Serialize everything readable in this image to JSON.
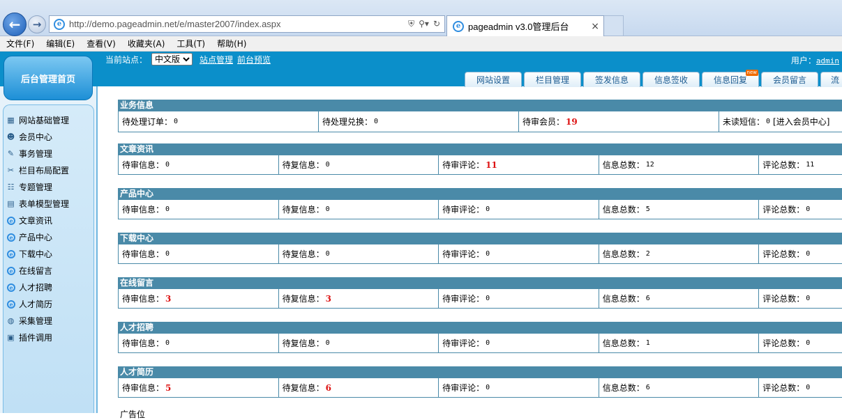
{
  "browser": {
    "url": "http://demo.pageadmin.net/e/master2007/index.aspx",
    "tab_title": "pageadmin v3.0管理后台",
    "menu": [
      "文件(F)",
      "编辑(E)",
      "查看(V)",
      "收藏夹(A)",
      "工具(T)",
      "帮助(H)"
    ]
  },
  "header": {
    "home_label": "后台管理首页",
    "site_label": "当前站点：",
    "site_selected": "中文版",
    "site_manage": "站点管理",
    "preview": "前台预览",
    "user_label": "用户：",
    "user_name": "admin"
  },
  "tabs": [
    {
      "label": "网站设置"
    },
    {
      "label": "栏目管理"
    },
    {
      "label": "签发信息"
    },
    {
      "label": "信息签收"
    },
    {
      "label": "信息回复",
      "badge": "new"
    },
    {
      "label": "会员留言"
    },
    {
      "label": "流"
    }
  ],
  "sidebar": {
    "items": [
      {
        "label": "网站基础管理",
        "icon": "site-manage-icon"
      },
      {
        "label": "会员中心",
        "icon": "members-icon"
      },
      {
        "label": "事务管理",
        "icon": "affairs-icon"
      },
      {
        "label": "栏目布局配置",
        "icon": "tools-icon"
      },
      {
        "label": "专题管理",
        "icon": "topics-icon"
      },
      {
        "label": "表单模型管理",
        "icon": "form-book-icon"
      },
      {
        "label": "文章资讯",
        "icon": "ie-icon"
      },
      {
        "label": "产品中心",
        "icon": "ie-icon"
      },
      {
        "label": "下载中心",
        "icon": "ie-icon"
      },
      {
        "label": "在线留言",
        "icon": "ie-icon"
      },
      {
        "label": "人才招聘",
        "icon": "ie-icon"
      },
      {
        "label": "人才简历",
        "icon": "ie-icon"
      },
      {
        "label": "采集管理",
        "icon": "globe-icon"
      },
      {
        "label": "插件调用",
        "icon": "plugin-icon"
      }
    ]
  },
  "business": {
    "title": "业务信息",
    "cells": [
      {
        "label": "待处理订单：",
        "value": "0"
      },
      {
        "label": "待处理兑换：",
        "value": "0"
      },
      {
        "label": "待审会员：",
        "value": "19",
        "hot": true
      },
      {
        "label": "未读短信：",
        "value": "0",
        "link": "[进入会员中心]"
      }
    ]
  },
  "modules": [
    {
      "title": "文章资讯",
      "cells": [
        [
          "待审信息：",
          "0"
        ],
        [
          "待复信息：",
          "0"
        ],
        [
          "待审评论：",
          "11"
        ],
        [
          "信息总数：",
          "12"
        ],
        [
          "评论总数：",
          "11"
        ]
      ]
    },
    {
      "title": "产品中心",
      "cells": [
        [
          "待审信息：",
          "0"
        ],
        [
          "待复信息：",
          "0"
        ],
        [
          "待审评论：",
          "0"
        ],
        [
          "信息总数：",
          "5"
        ],
        [
          "评论总数：",
          "0"
        ]
      ]
    },
    {
      "title": "下载中心",
      "cells": [
        [
          "待审信息：",
          "0"
        ],
        [
          "待复信息：",
          "0"
        ],
        [
          "待审评论：",
          "0"
        ],
        [
          "信息总数：",
          "2"
        ],
        [
          "评论总数：",
          "0"
        ]
      ]
    },
    {
      "title": "在线留言",
      "cells": [
        [
          "待审信息：",
          "3"
        ],
        [
          "待复信息：",
          "3"
        ],
        [
          "待审评论：",
          "0"
        ],
        [
          "信息总数：",
          "6"
        ],
        [
          "评论总数：",
          "0"
        ]
      ]
    },
    {
      "title": "人才招聘",
      "cells": [
        [
          "待审信息：",
          "0"
        ],
        [
          "待复信息：",
          "0"
        ],
        [
          "待审评论：",
          "0"
        ],
        [
          "信息总数：",
          "1"
        ],
        [
          "评论总数：",
          "0"
        ]
      ]
    },
    {
      "title": "人才简历",
      "cells": [
        [
          "待审信息：",
          "5"
        ],
        [
          "待复信息：",
          "6"
        ],
        [
          "待审评论：",
          "0"
        ],
        [
          "信息总数：",
          "6"
        ],
        [
          "评论总数：",
          "0"
        ]
      ]
    }
  ],
  "hot_highlight": {
    "文章资讯": [
      2
    ],
    "在线留言": [
      0,
      1
    ],
    "人才简历": [
      0,
      1
    ]
  },
  "footer_hint": "广告位"
}
